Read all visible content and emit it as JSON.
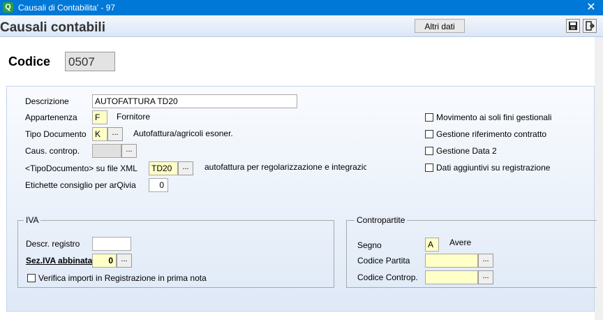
{
  "window": {
    "title": "Causali di Contabilita' - 97",
    "app_icon_glyph": "Q"
  },
  "header": {
    "title": "Causali contabili",
    "altri_dati_label": "Altri dati"
  },
  "codice": {
    "label": "Codice",
    "value": "0507"
  },
  "form": {
    "descrizione_label": "Descrizione",
    "descrizione_value": "AUTOFATTURA TD20",
    "appartenenza_label": "Appartenenza",
    "appartenenza_value": "F",
    "appartenenza_desc": "Fornitore",
    "tipo_documento_label": "Tipo Documento",
    "tipo_documento_value": "K",
    "tipo_documento_desc": "Autofattura/agricoli esoner.",
    "caus_controp_label": "Caus. controp.",
    "caus_controp_value": "",
    "tipo_doc_xml_label": "<TipoDocumento> su file XML",
    "tipo_doc_xml_value": "TD20",
    "tipo_doc_xml_desc": "autofattura per regolarizzazione e integrazic",
    "etichette_label": "Etichette consiglio per arQivia",
    "etichette_value": "0",
    "dots_label": "..."
  },
  "checkboxes": {
    "movimento": "Movimento ai soli fini gestionali",
    "riferimento": "Gestione riferimento contratto",
    "data2": "Gestione Data 2",
    "dati_aggiuntivi": "Dati aggiuntivi su registrazione"
  },
  "iva": {
    "title": "IVA",
    "descr_registro_label": "Descr. registro",
    "descr_registro_value": "",
    "sez_iva_label": "Sez.IVA abbinata",
    "sez_iva_value": "0",
    "verifica_label": "Verifica importi in Registrazione in prima nota"
  },
  "contropartite": {
    "title": "Contropartite",
    "segno_label": "Segno",
    "segno_value": "A",
    "segno_desc": "Avere",
    "codice_partita_label": "Codice Partita",
    "codice_partita_value": "",
    "codice_controp_label": "Codice Controp.",
    "codice_controp_value": ""
  }
}
